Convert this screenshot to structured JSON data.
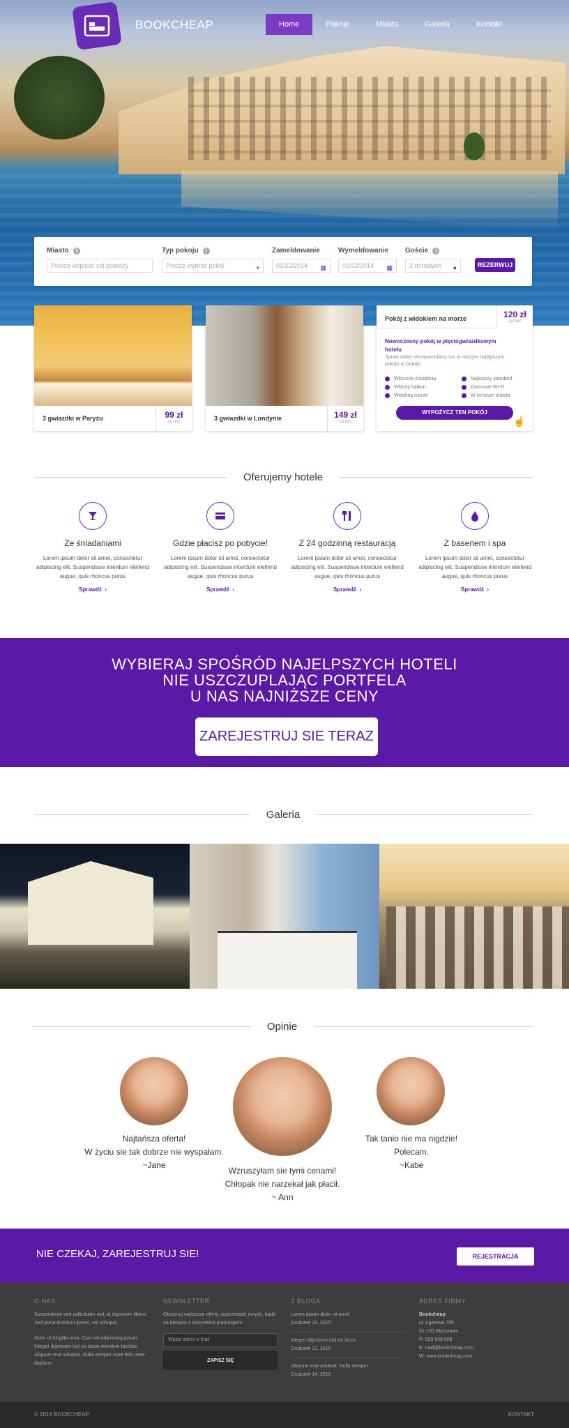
{
  "brand": {
    "name": "BOOKCHEAP"
  },
  "nav": [
    {
      "label": "Home",
      "active": true
    },
    {
      "label": "Pokoje"
    },
    {
      "label": "Miasta"
    },
    {
      "label": "Galeria"
    },
    {
      "label": "Kontakt"
    }
  ],
  "search": {
    "city": {
      "label": "Miasto",
      "placeholder": "Proszę wspisać cel podróży"
    },
    "room_type": {
      "label": "Typ pokoju",
      "placeholder": "Proszę wybrać pokój"
    },
    "checkin": {
      "label": "Zameldowanie",
      "value": "01/22/2014"
    },
    "checkout": {
      "label": "Wymeldowanie",
      "value": "01/22/2014"
    },
    "guests": {
      "label": "Goście",
      "value": "2 dorosłych"
    },
    "submit": "REZERWUJ"
  },
  "offers": [
    {
      "caption": "3 gwiazdki w Paryżu",
      "price": "99 zł",
      "per": "za noc"
    },
    {
      "caption": "3 gwiazdki w Londynie",
      "price": "149 zł",
      "per": "za noc"
    }
  ],
  "promo": {
    "title": "Pokój z widokiem na morze",
    "price": "120 zł",
    "per": "za noc",
    "headline": "Nowoczesny pokój w pięciogwiazdkowym hotelu",
    "desc": "Spraw sobie niezapomnianą noc w naszym najlepszym pokoju w Dubaju",
    "features_left": [
      "Wliczone śniadania",
      "Własny balkon",
      "Widokna morze"
    ],
    "features_right": [
      "Najlepszy standard",
      "Darmowe Wi-Fi",
      "W centrum miasta"
    ],
    "cta": "WYPOŻYCZ TEN POKÓJ"
  },
  "features_section": {
    "title": "Oferujemy hotele",
    "items": [
      {
        "title": "Ze śniadaniami",
        "text": "Lorem ipsum dolor sit amet, consectetur adipiscing elit. Suspendisse interdum eleifend augue, quis rhoncus purus",
        "more": "Sprawdź",
        "icon": "cocktail-icon"
      },
      {
        "title": "Gdzie płacisz po pobycie!",
        "text": "Lorem ipsum dolor sit amet, consectetur adipiscing elit. Suspendisse interdum eleifend augue, quis rhoncus purus",
        "more": "Sprawdź",
        "icon": "credit-card-icon"
      },
      {
        "title": "Z 24 godzinną restauracją",
        "text": "Lorem ipsum dolor sit amet, consectetur adipiscing elit. Suspendisse interdum eleifend augue, quis rhoncus purus",
        "more": "Sprawdź",
        "icon": "cutlery-icon"
      },
      {
        "title": "Z basenem i spa",
        "text": "Lorem ipsum dolor sit amet, consectetur adipiscing elit. Suspendisse interdum eleifend augue, quis rhoncus purus",
        "more": "Sprawdź",
        "icon": "water-drop-icon"
      }
    ]
  },
  "banner": {
    "lines": [
      "WYBIERAJ SPOŚRÓD NAJELPSZYCH HOTELI",
      "NIE USZCZUPLAJĄC PORTFELA",
      "U NAS NAJNIŻSZE CENY"
    ],
    "button": "ZAREJESTRUJ SIE TERAZ"
  },
  "gallery": {
    "title": "Galeria"
  },
  "testimonials": {
    "title": "Opinie",
    "items": [
      {
        "lines": [
          "Najtańsza oferta!",
          "W życiu sie tak dobrze nie wyspałam.",
          "~Jane"
        ]
      },
      {
        "lines": [
          "Wzruszyłam sie tymi cenami!",
          "Chłopak nie narzekał jak płacił.",
          "~ Ann"
        ]
      },
      {
        "lines": [
          "Tak tanio nie ma nigdzie!",
          "Polecam.",
          "~Katie"
        ]
      }
    ]
  },
  "register_strip": {
    "text": "NIE CZEKAJ, ZAREJESTRUJ SIE!",
    "button": "REJESTRACJA"
  },
  "footer": {
    "about": {
      "title": "O NAS",
      "p1": "Suspendisse sed sollicitudin nisl, at dignissim libero. Sed porta tincidunt ipsum, vel volutpat.",
      "p2": "Nunc ut fringilla urna. Cras vel adipiscing ipsum. Integer dignissim nisl eu lacus interdum facilisis. Aliquam erat volutpat. Nulla semper vitae felis vitae dapibus."
    },
    "newsletter": {
      "title": "NEWSLETTER",
      "text": "Otrzymuj najlepsze oferty, wyprzedaże innych, bądź na bieżąco z wszystkimi promocjami",
      "placeholder": "Wpisz adres e-mail",
      "button": "ZAPISZ SIĘ"
    },
    "blog": {
      "title": "Z BLOGA",
      "posts": [
        {
          "title": "Lorem ipsum dolor sit amet",
          "date": "Grudzień 23, 2015"
        },
        {
          "title": "Integer dignissim nisl eu lacus",
          "date": "Grudzień 21, 2015"
        },
        {
          "title": "Aliquam erat volutpat. Nulla semper",
          "date": "Grudzień 14, 2015"
        }
      ]
    },
    "address": {
      "title": "ADRES FIRMY",
      "lines": [
        "Bookcheap",
        "ul. Agatowa 795",
        "01-100 Warszawa",
        "P: 509 509 509",
        "E: mail@bookcheap.com",
        "W: www.bookcheap.com"
      ]
    }
  },
  "copyright": {
    "left": "© 2016 BOOKCHEAP",
    "right": "KONTAKT"
  },
  "colors": {
    "accent": "#5b1aa5",
    "logo": "#6a2bb8",
    "footer": "#3d3d3d"
  }
}
